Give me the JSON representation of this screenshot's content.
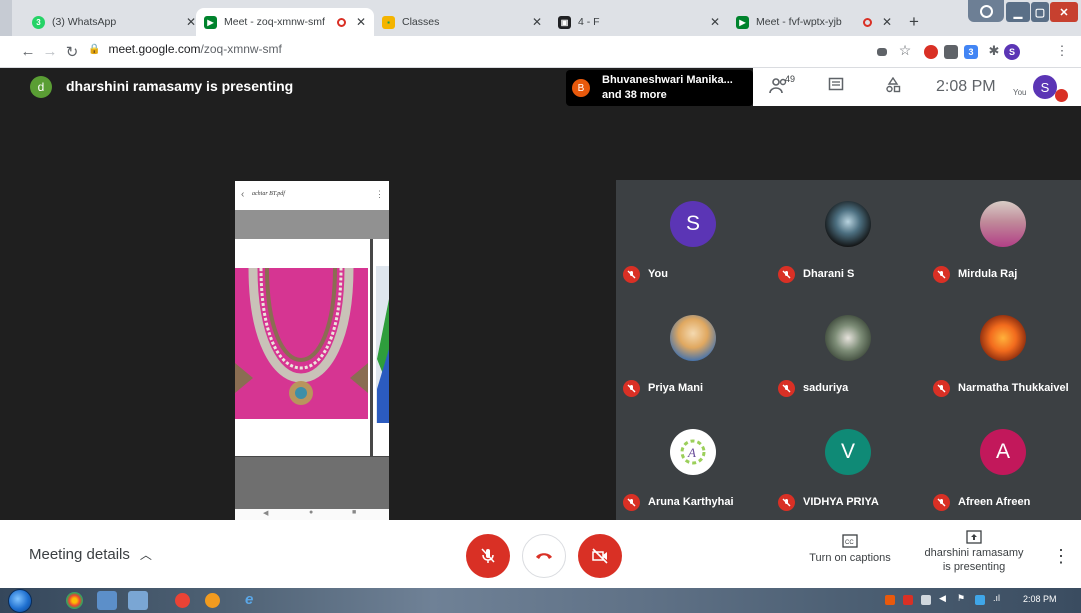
{
  "browser": {
    "tabs": [
      {
        "title": "(3) WhatsApp",
        "active": false
      },
      {
        "title": "Meet - zoq-xmnw-smf",
        "active": true
      },
      {
        "title": "Classes",
        "active": false
      },
      {
        "title": "4 - F",
        "active": false
      },
      {
        "title": "Meet - fvf-wptx-yjb",
        "active": false
      }
    ],
    "url_host": "meet.google.com",
    "url_path": "/zoq-xmnw-smf",
    "profile_initial": "S",
    "accent": "#1a73e8"
  },
  "meet": {
    "presenter_initial": "d",
    "presenter_text": "dharshini ramasamy is presenting",
    "joiner_initial": "B",
    "joiner_line1": "Bhuvaneshwari Manika...",
    "joiner_line2": "and 38 more",
    "participant_count": "49",
    "clock": "2:08 PM",
    "you_label": "You",
    "self_initial": "S",
    "present_filename": "achiar BT.pdf",
    "participants": [
      {
        "name": "You",
        "initial": "S",
        "avatar": "initial",
        "color": "#5b35b5"
      },
      {
        "name": "Dharani S",
        "initial": "",
        "avatar": "photo",
        "color": "#3a4f5c"
      },
      {
        "name": "Mirdula Raj",
        "initial": "",
        "avatar": "photo",
        "color": "#b9a090"
      },
      {
        "name": "Priya Mani",
        "initial": "",
        "avatar": "photo",
        "color": "#e7c9a2"
      },
      {
        "name": "saduriya",
        "initial": "",
        "avatar": "photo",
        "color": "#5e6b58"
      },
      {
        "name": "Narmatha Thukkaivel",
        "initial": "",
        "avatar": "photo",
        "color": "#e0561c"
      },
      {
        "name": "Aruna Karthyhai",
        "initial": "",
        "avatar": "photo",
        "color": "#ffffff"
      },
      {
        "name": "VIDHYA PRIYA",
        "initial": "V",
        "avatar": "initial",
        "color": "#0f8a76"
      },
      {
        "name": "Afreen Afreen",
        "initial": "A",
        "avatar": "initial",
        "color": "#c2185b"
      }
    ]
  },
  "controls": {
    "meeting_details": "Meeting details",
    "captions_label": "Turn on captions",
    "presenting_line1": "dharshini ramasamy",
    "presenting_line2": "is presenting",
    "mute_color": "#d93025"
  },
  "taskbar": {
    "time": "2:08 PM"
  }
}
